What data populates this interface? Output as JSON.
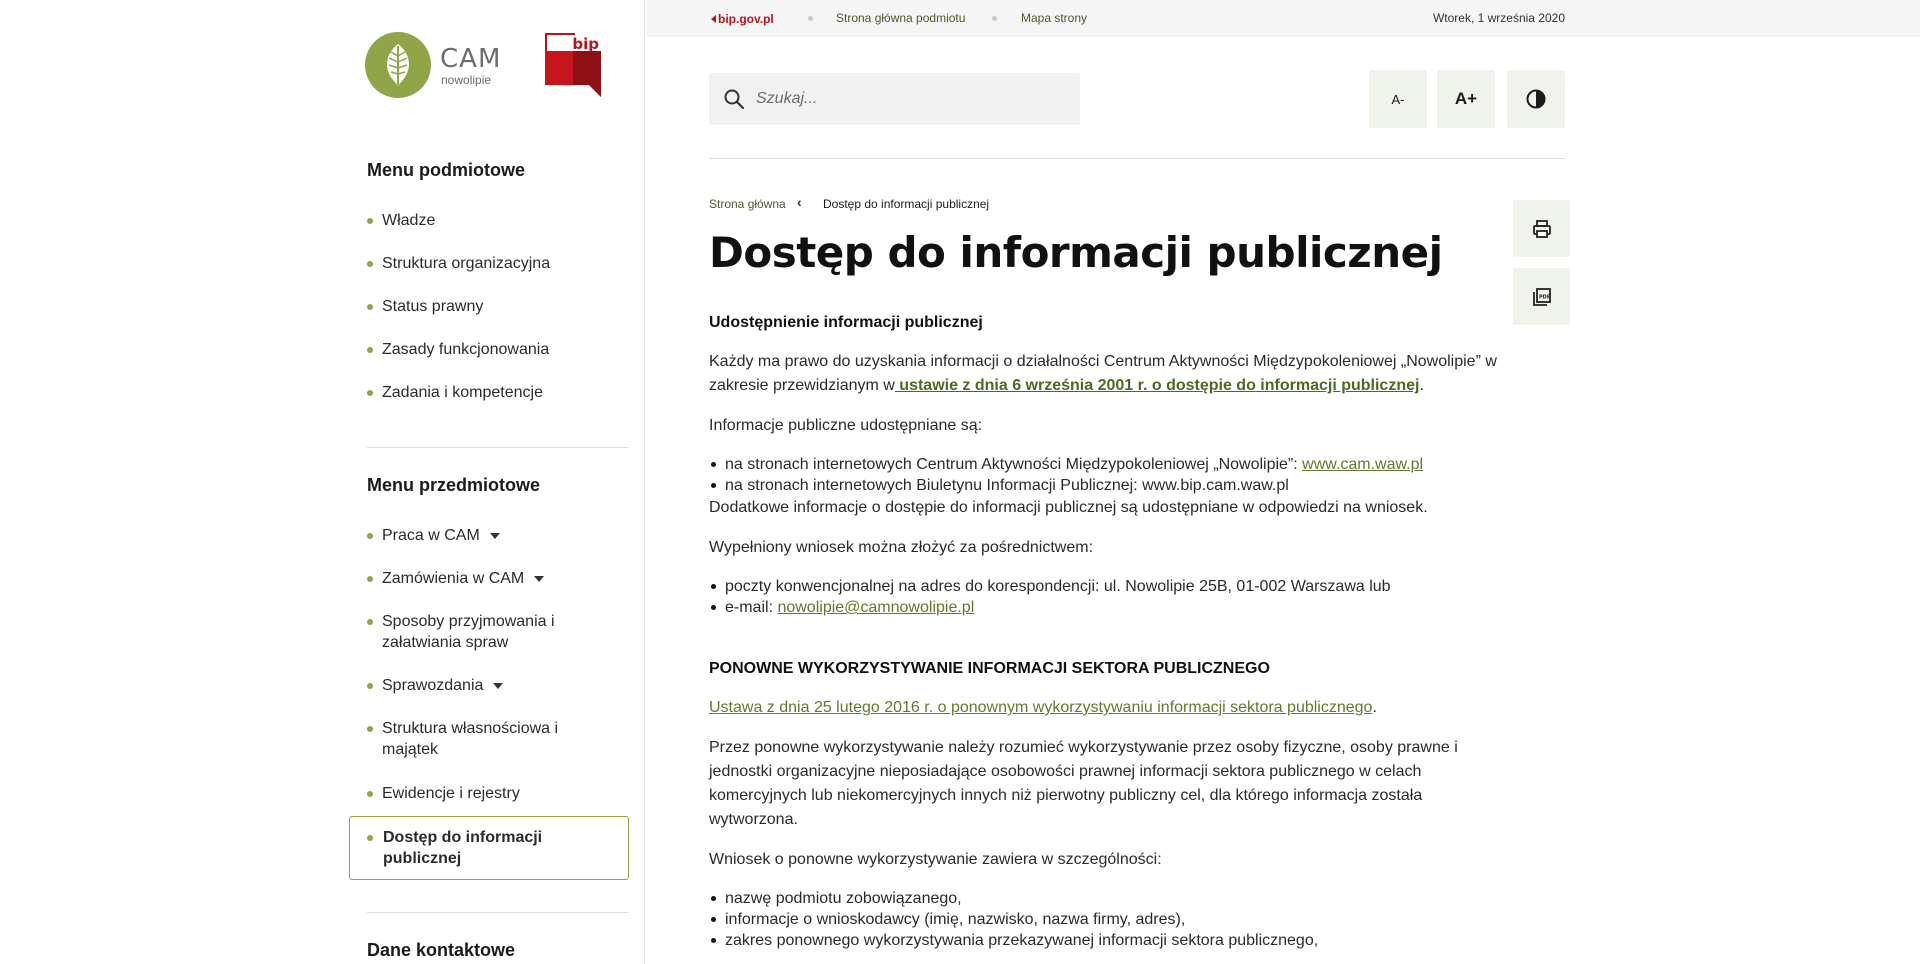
{
  "logos": {
    "cam_name": "CAM",
    "cam_sub": "nowolipie",
    "bip": "bip"
  },
  "sidebar": {
    "menu_podmiotowe": {
      "title": "Menu podmiotowe",
      "items": [
        "Władze",
        "Struktura organizacyjna",
        "Status prawny",
        "Zasady funkcjonowania",
        "Zadania i kompetencje"
      ]
    },
    "menu_przedmiotowe": {
      "title": "Menu przedmiotowe",
      "items": [
        "Praca w CAM",
        "Zamówienia w CAM",
        "Sposoby przyjmowania i załatwiania spraw",
        "Sprawozdania",
        "Struktura własnościowa i majątek",
        "Ewidencje i rejestry",
        "Dostęp do informacji publicznej"
      ]
    },
    "dane_kontaktowe": "Dane kontaktowe"
  },
  "topbar": {
    "bip_link": "bip.gov.pl",
    "home": "Strona główna podmiotu",
    "sitemap": "Mapa strony",
    "date": "Wtorek, 1 września 2020"
  },
  "search": {
    "placeholder": "Szukaj..."
  },
  "accessibility": {
    "smaller": "A-",
    "larger": "A+"
  },
  "breadcrumb": {
    "home": "Strona główna",
    "current": "Dostęp do informacji publicznej"
  },
  "page_title": "Dostęp do informacji publicznej",
  "content": {
    "h1": "Udostępnienie informacji publicznej",
    "p1_a": "Każdy ma prawo do uzyskania informacji o działalności Centrum Aktywności Międzypokoleniowej „Nowolipie” w zakresie przewidzianym w",
    "p1_link": " ustawie z dnia 6 września 2001 r. o dostępie do informacji publicznej",
    "p1_end": ".",
    "p2": "Informacje publiczne udostępniane są:",
    "li1_a": "na stronach internetowych Centrum Aktywności Międzypokoleniowej „Nowolipie”: ",
    "li1_link": "www.cam.waw.pl",
    "li2": "na stronach internetowych Biuletynu Informacji Publicznej: www.bip.cam.waw.pl",
    "p3": "Dodatkowe informacje o dostępie do informacji publicznej  są udostępniane w odpowiedzi na wniosek.",
    "p4": "Wypełniony wniosek można złożyć za pośrednictwem:",
    "li3": "poczty konwencjonalnej na adres do korespondencji: ul. Nowolipie 25B, 01-002 Warszawa lub",
    "li4_a": "e-mail: ",
    "li4_link": "nowolipie@camnowolipie.pl",
    "h2": "PONOWNE WYKORZYSTYWANIE INFORMACJI SEKTORA PUBLICZNEGO",
    "p5_link": "Ustawa z dnia 25 lutego 2016 r. o ponownym wykorzystywaniu informacji sektora publicznego",
    "p5_end": ".",
    "p6": "Przez ponowne wykorzystywanie należy rozumieć wykorzystywanie przez osoby fizyczne, osoby prawne i jednostki organizacyjne nieposiadające osobowości prawnej informacji sektora publicznego w celach komercyjnych lub niekomercyjnych innych niż pierwotny publiczny cel, dla którego informacja została wytworzona.",
    "p7": "Wniosek o ponowne wykorzystywanie zawiera w szczególności:",
    "li5": "nazwę podmiotu zobowiązanego,",
    "li6": "informacje o wnioskodawcy (imię, nazwisko, nazwa firmy, adres),",
    "li7": "zakres ponownego wykorzystywania przekazywanej informacji sektora publicznego,"
  },
  "colors": {
    "accent": "#8fa548",
    "bip_red": "#b7141b",
    "link": "#62792d"
  },
  "icons": [
    "leaf-logo-icon",
    "search-icon",
    "contrast-icon",
    "print-icon",
    "pdf-icon",
    "chevron-left-icon",
    "caret-down-icon"
  ]
}
